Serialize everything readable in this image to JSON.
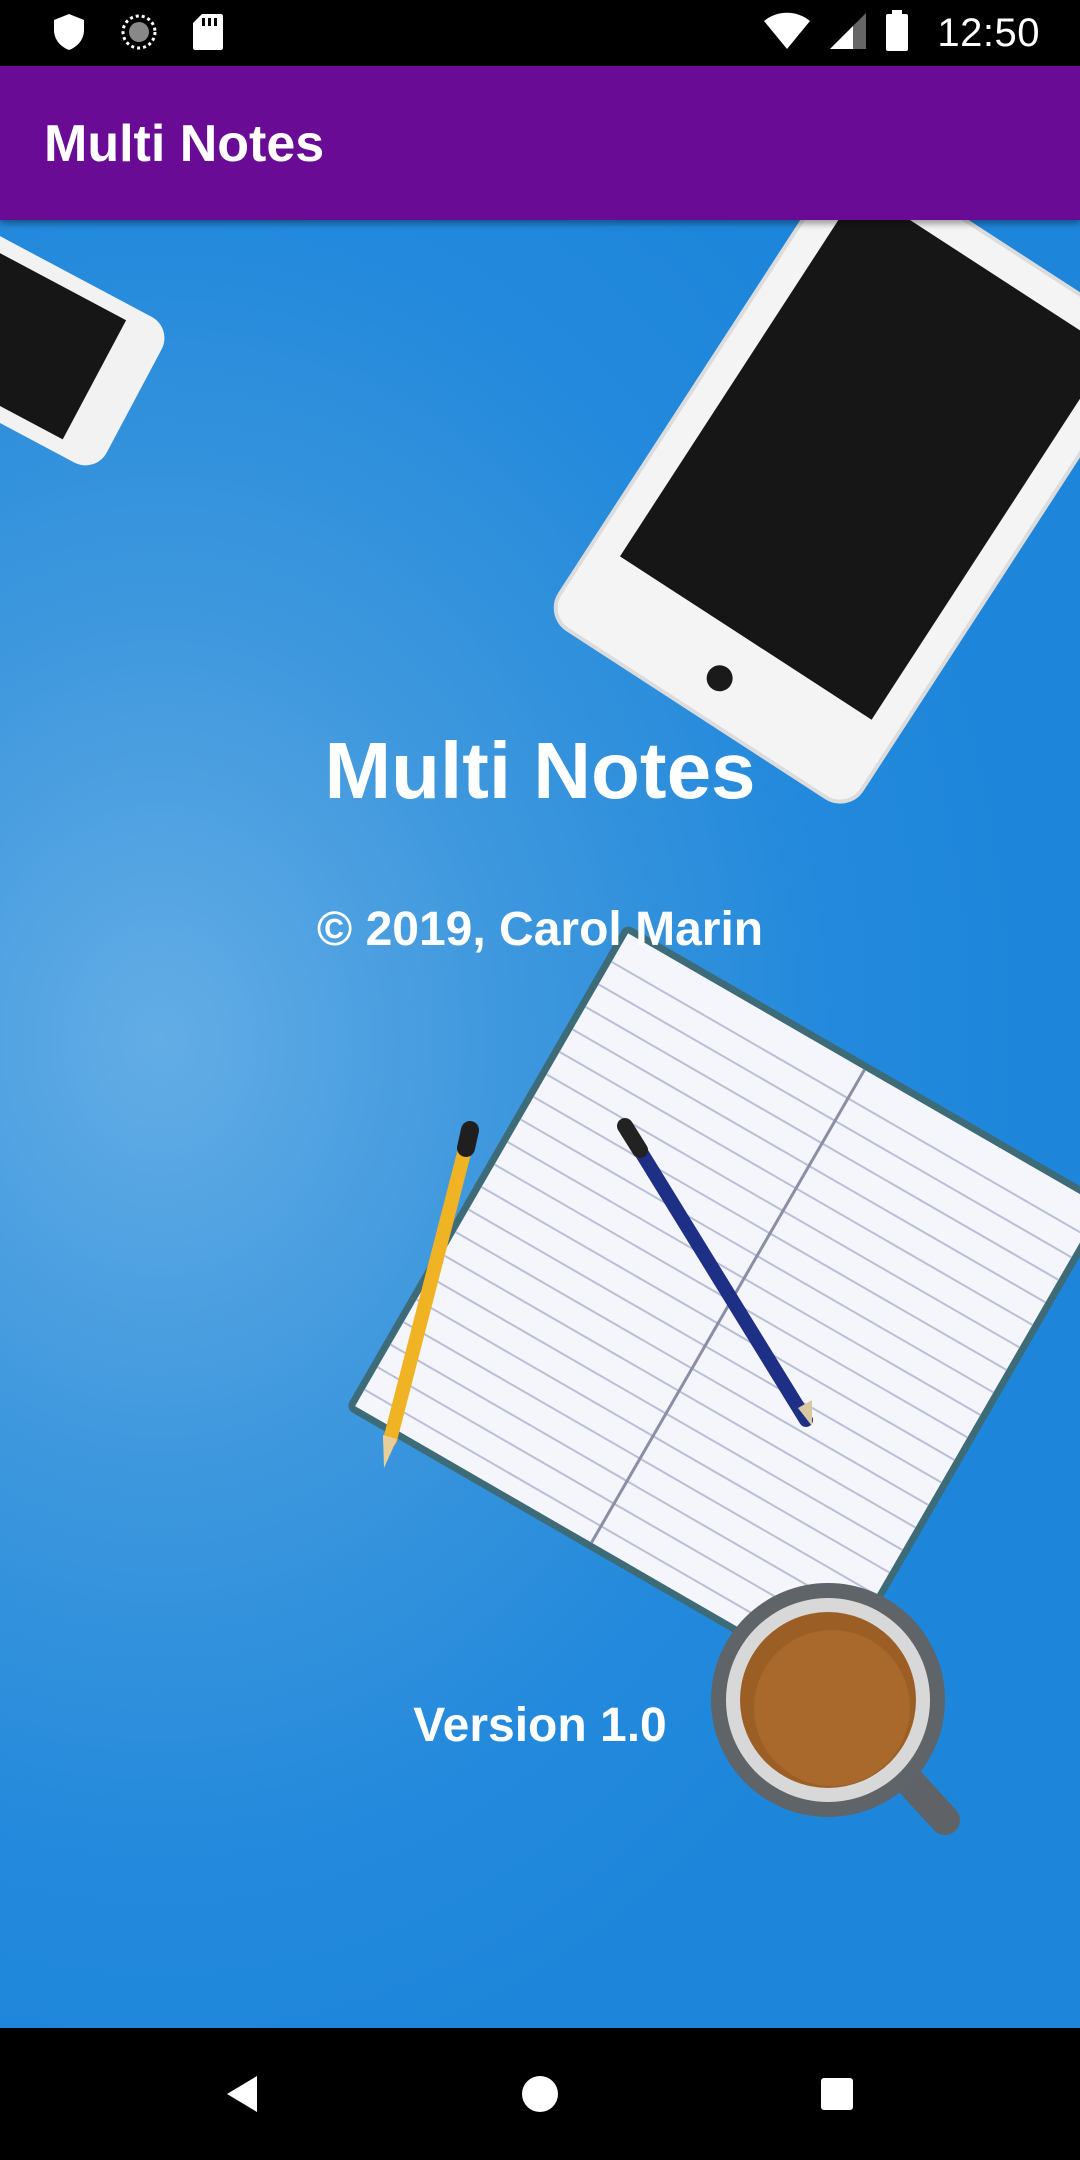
{
  "status_bar": {
    "time": "12:50",
    "icons": [
      "shield-icon",
      "sync-icon",
      "sd-card-icon",
      "wifi-icon",
      "signal-icon",
      "battery-icon"
    ]
  },
  "app_bar": {
    "title": "Multi Notes",
    "color": "#6a0b96"
  },
  "about": {
    "title": "Multi Notes",
    "copyright": "© 2019, Carol Marin",
    "version": "Version 1.0"
  },
  "nav_bar": {
    "buttons": [
      "back-icon",
      "home-icon",
      "recents-icon"
    ]
  }
}
